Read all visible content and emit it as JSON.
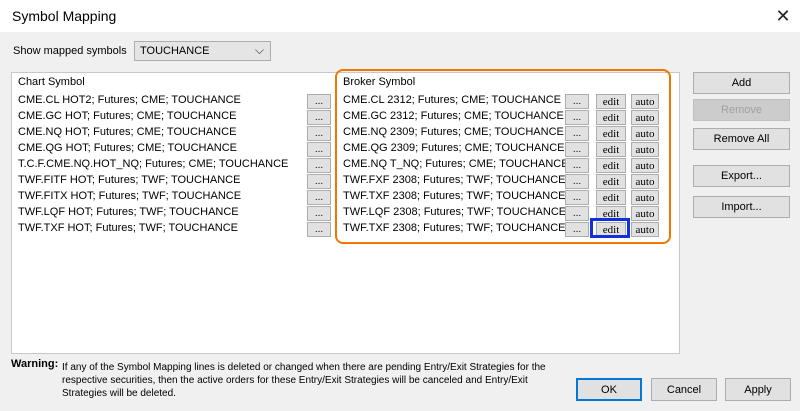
{
  "window": {
    "title": "Symbol Mapping",
    "close_glyph": "✕"
  },
  "filter": {
    "label": "Show mapped symbols",
    "value": "TOUCHANCE",
    "arrow": "⌵"
  },
  "table": {
    "chart_header": "Chart Symbol",
    "broker_header": "Broker Symbol",
    "dots_label": "...",
    "edit_label": "edit",
    "auto_label": "auto",
    "rows": [
      {
        "chart": "CME.CL HOT2; Futures; CME; TOUCHANCE",
        "broker": "CME.CL 2312; Futures; CME; TOUCHANCE"
      },
      {
        "chart": "CME.GC HOT; Futures; CME; TOUCHANCE",
        "broker": "CME.GC 2312; Futures; CME; TOUCHANCE"
      },
      {
        "chart": "CME.NQ HOT; Futures; CME; TOUCHANCE",
        "broker": "CME.NQ 2309; Futures; CME; TOUCHANCE"
      },
      {
        "chart": "CME.QG HOT; Futures; CME; TOUCHANCE",
        "broker": "CME.QG 2309; Futures; CME; TOUCHANCE"
      },
      {
        "chart": "T.C.F.CME.NQ.HOT_NQ; Futures; CME; TOUCHANCE",
        "broker": "CME.NQ T_NQ; Futures; CME; TOUCHANCE"
      },
      {
        "chart": "TWF.FITF HOT; Futures; TWF; TOUCHANCE",
        "broker": "TWF.FXF 2308; Futures; TWF; TOUCHANCE"
      },
      {
        "chart": "TWF.FITX HOT; Futures; TWF; TOUCHANCE",
        "broker": "TWF.TXF 2308; Futures; TWF; TOUCHANCE"
      },
      {
        "chart": "TWF.LQF HOT; Futures; TWF; TOUCHANCE",
        "broker": "TWF.LQF 2308; Futures; TWF; TOUCHANCE"
      },
      {
        "chart": "TWF.TXF HOT; Futures; TWF; TOUCHANCE",
        "broker": "TWF.TXF 2308; Futures; TWF; TOUCHANCE"
      }
    ]
  },
  "side_buttons": {
    "add": "Add",
    "remove": "Remove",
    "remove_all": "Remove All",
    "export": "Export...",
    "import": "Import..."
  },
  "warning": {
    "label": "Warning:",
    "text": "If any of the Symbol Mapping lines is deleted or changed when there are pending Entry/Exit Strategies for the respective securities, then the active orders for these Entry/Exit Strategies will be canceled and Entry/Exit Strategies will be deleted."
  },
  "footer": {
    "ok": "OK",
    "cancel": "Cancel",
    "apply": "Apply"
  },
  "colors": {
    "highlight_orange": "#f07800",
    "highlight_blue": "#1030e0",
    "focus_blue": "#0078d7"
  }
}
